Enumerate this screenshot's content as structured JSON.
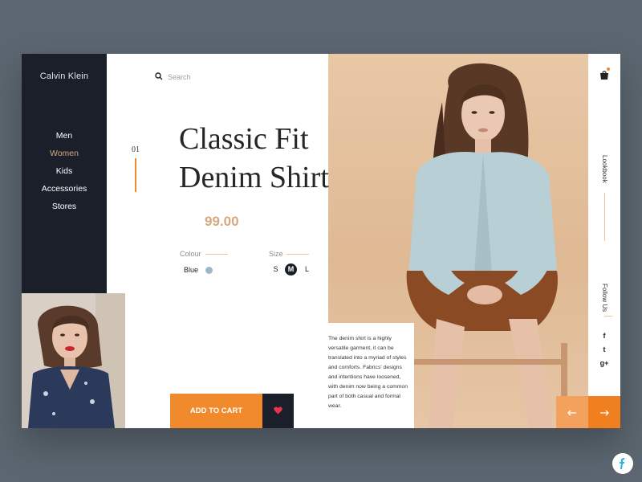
{
  "brand": "Calvin Klein",
  "nav": [
    "Men",
    "Women",
    "Kids",
    "Accessories",
    "Stores"
  ],
  "nav_active_index": 1,
  "search": {
    "placeholder": "Search"
  },
  "indicator": {
    "number": "01",
    "progress": 1.0
  },
  "product": {
    "title_line1": "Classic Fit",
    "title_line2": "Denim Shirt",
    "price": "99.00",
    "colour_label": "Colour",
    "colour_value": "Blue",
    "size_label": "Size",
    "sizes": [
      "S",
      "M",
      "L"
    ],
    "selected_size": "M",
    "description": "The denim shirt is a highly versatile garment, it can be translated into a myriad of styles and comforts. Fabrics' designs and intentions have loosened, with denim now being a common part of both casual and formal wear."
  },
  "actions": {
    "add_to_cart": "ADD TO CART"
  },
  "right_rail": {
    "lookbook": "Lookbook",
    "follow_us": "Follow Us",
    "social": [
      {
        "name": "facebook-icon",
        "glyph": "f"
      },
      {
        "name": "twitter-icon",
        "glyph": "t"
      },
      {
        "name": "google-plus-icon",
        "glyph": "g+"
      }
    ]
  },
  "colors": {
    "accent": "#f08a2c",
    "gold": "#d5a97c",
    "dark": "#1b1f2a",
    "background": "#5b6670",
    "swatch_blue": "#9fb8c7"
  }
}
